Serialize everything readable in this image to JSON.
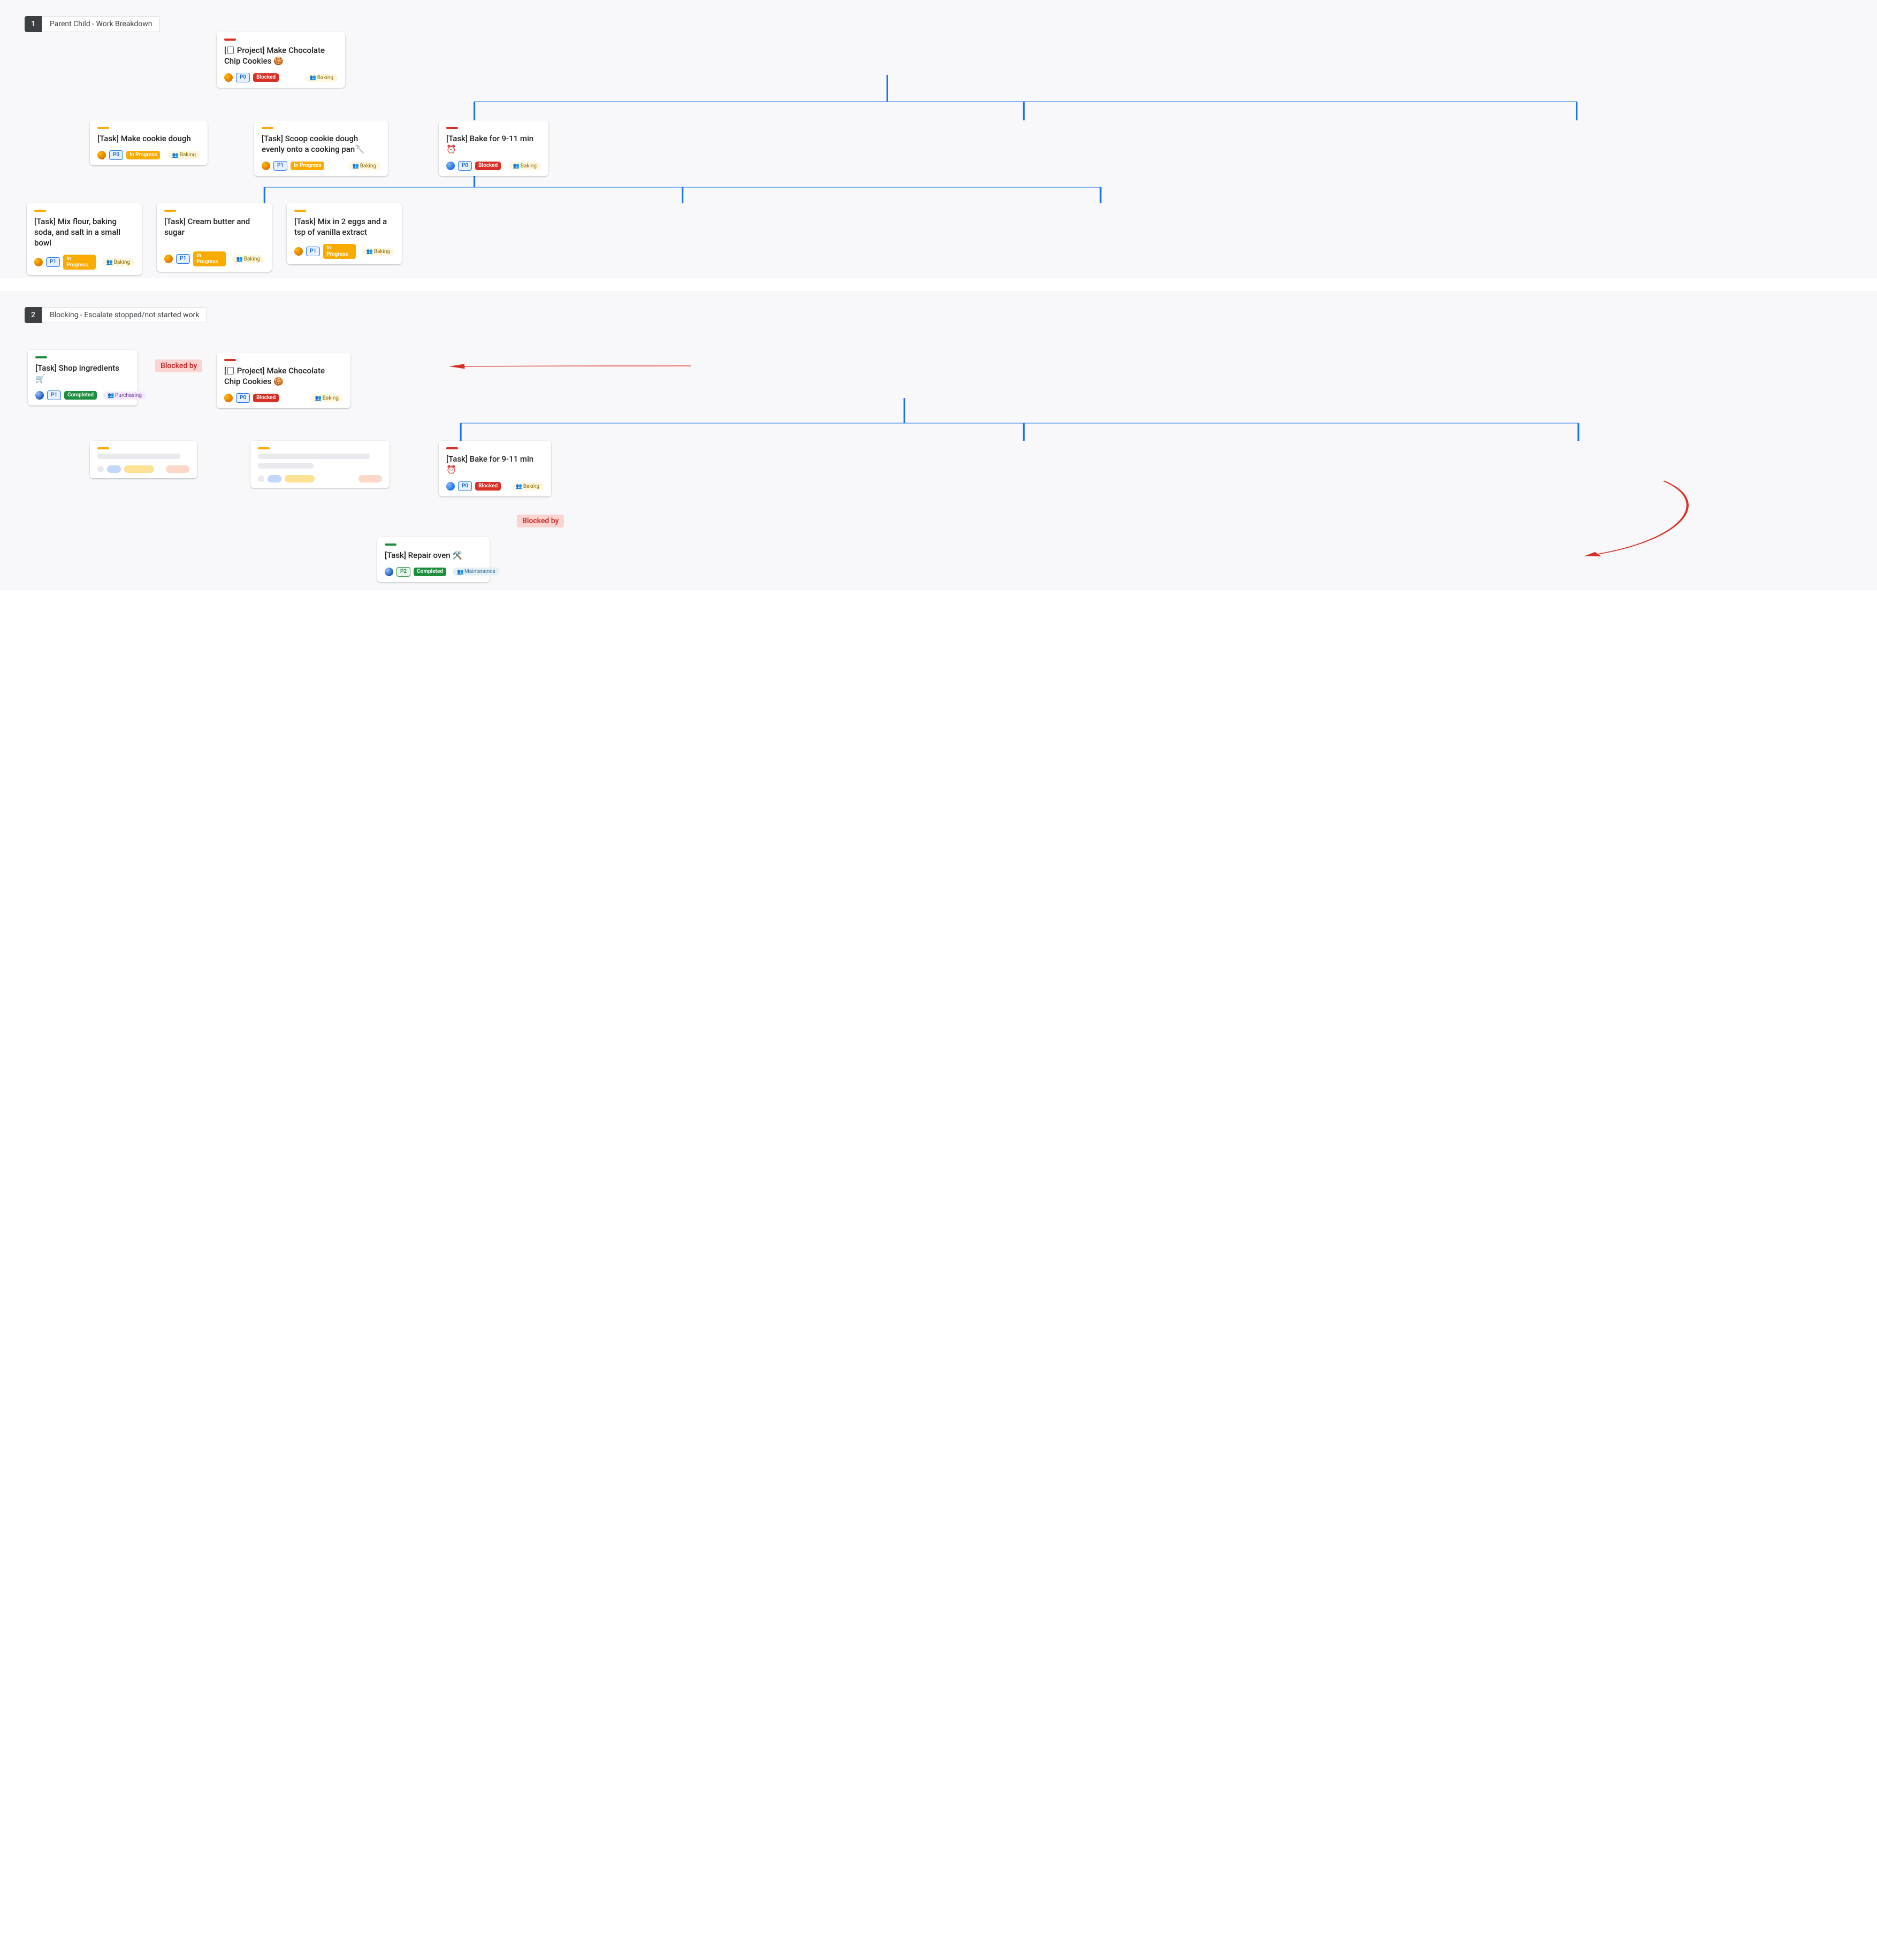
{
  "sections": {
    "s1": {
      "num": "1",
      "title": "Parent Child - Work Breakdown"
    },
    "s2": {
      "num": "2",
      "title": "Blocking - Escalate stopped/not started work"
    }
  },
  "labels": {
    "blocked_by": "Blocked by"
  },
  "priority": {
    "p0": "P0",
    "p1": "P1",
    "p2": "P2"
  },
  "status": {
    "blocked": "Blocked",
    "inprog": "In Progress",
    "done": "Completed"
  },
  "tags": {
    "baking": "Baking",
    "purchasing": "Purchasing",
    "maint": "Maintenance"
  },
  "cards": {
    "root": {
      "pre": "[",
      "post": " Project] Make Chocolate Chip Cookies 🍪"
    },
    "dough": {
      "title": "[Task] Make cookie dough"
    },
    "scoop": {
      "title": "[Task] Scoop cookie dough evenly onto a cooking pan🥄"
    },
    "bake": {
      "title": "[Task] Bake for 9-11 min ⏰"
    },
    "mix1": {
      "title": "[Task] Mix flour, baking soda, and salt in a small bowl"
    },
    "cream": {
      "title": "[Task] Cream butter and sugar"
    },
    "mix2": {
      "title": "[Task] Mix in 2 eggs and a tsp of vanilla extract"
    },
    "shop": {
      "title": "[Task] Shop ingredients 🛒"
    },
    "repair": {
      "title": "[Task] Repair oven 🛠️"
    }
  }
}
